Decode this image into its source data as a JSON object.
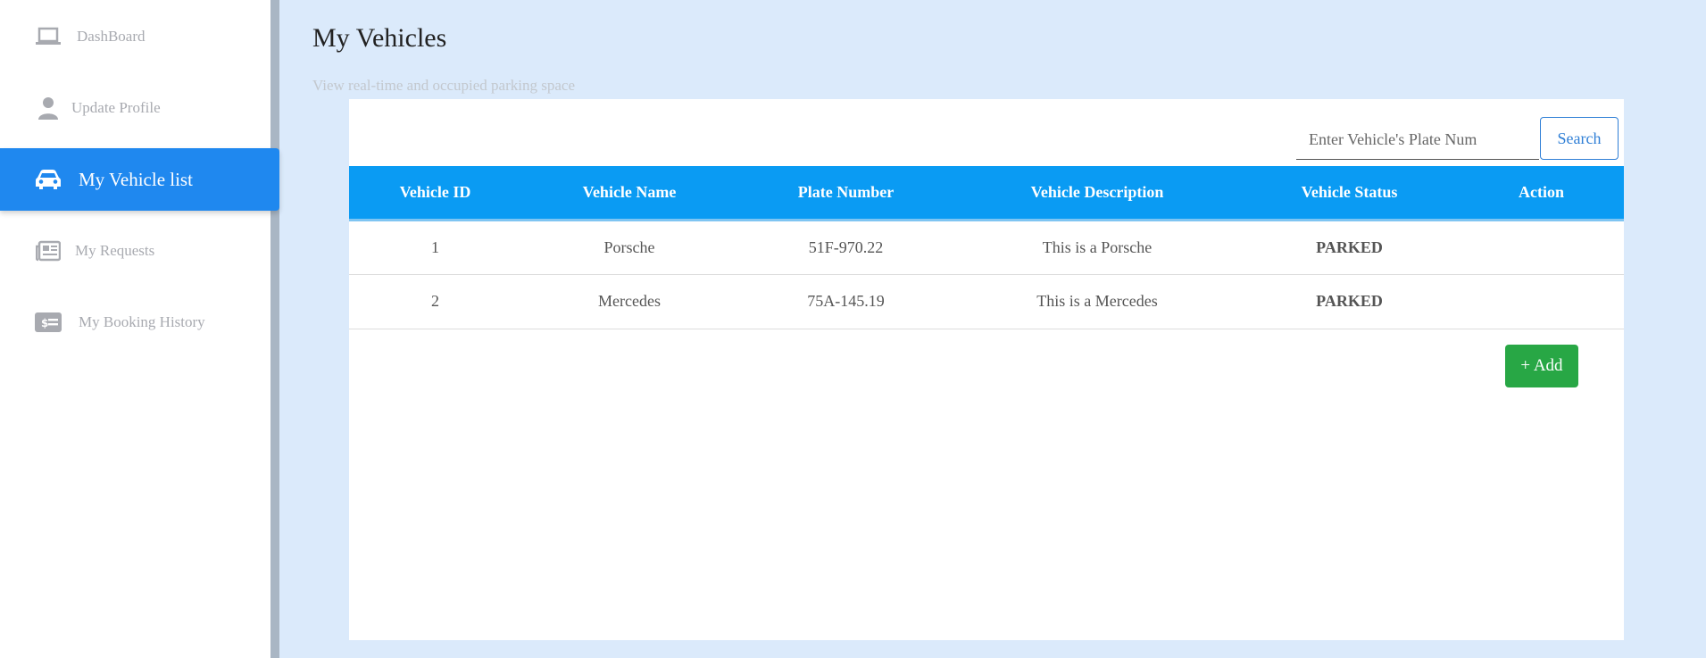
{
  "sidebar": {
    "items": [
      {
        "label": "DashBoard",
        "icon": "laptop-icon"
      },
      {
        "label": "Update Profile",
        "icon": "user-icon"
      },
      {
        "label": "My Vehicle list",
        "icon": "car-icon"
      },
      {
        "label": "My Requests",
        "icon": "newspaper-icon"
      },
      {
        "label": "My Booking History",
        "icon": "money-bill-icon"
      }
    ]
  },
  "main": {
    "title": "My Vehicles",
    "subtitle": "View real-time and occupied parking space",
    "search": {
      "placeholder": "Enter Vehicle's Plate Num",
      "button_label": "Search"
    },
    "table": {
      "headers": [
        "Vehicle ID",
        "Vehicle Name",
        "Plate Number",
        "Vehicle Description",
        "Vehicle Status",
        "Action"
      ],
      "rows": [
        {
          "id": "1",
          "name": "Porsche",
          "plate": "51F-970.22",
          "description": "This is a Porsche",
          "status": "PARKED",
          "action": ""
        },
        {
          "id": "2",
          "name": "Mercedes",
          "plate": "75A-145.19",
          "description": "This is a Mercedes",
          "status": "PARKED",
          "action": ""
        }
      ]
    },
    "add_button_label": "+ Add"
  },
  "colors": {
    "background": "#dbeafb",
    "sidebar_active": "#1f88ef",
    "table_header": "#0a9bf3",
    "status_parked": "#118a1f",
    "add_button": "#28a745"
  }
}
